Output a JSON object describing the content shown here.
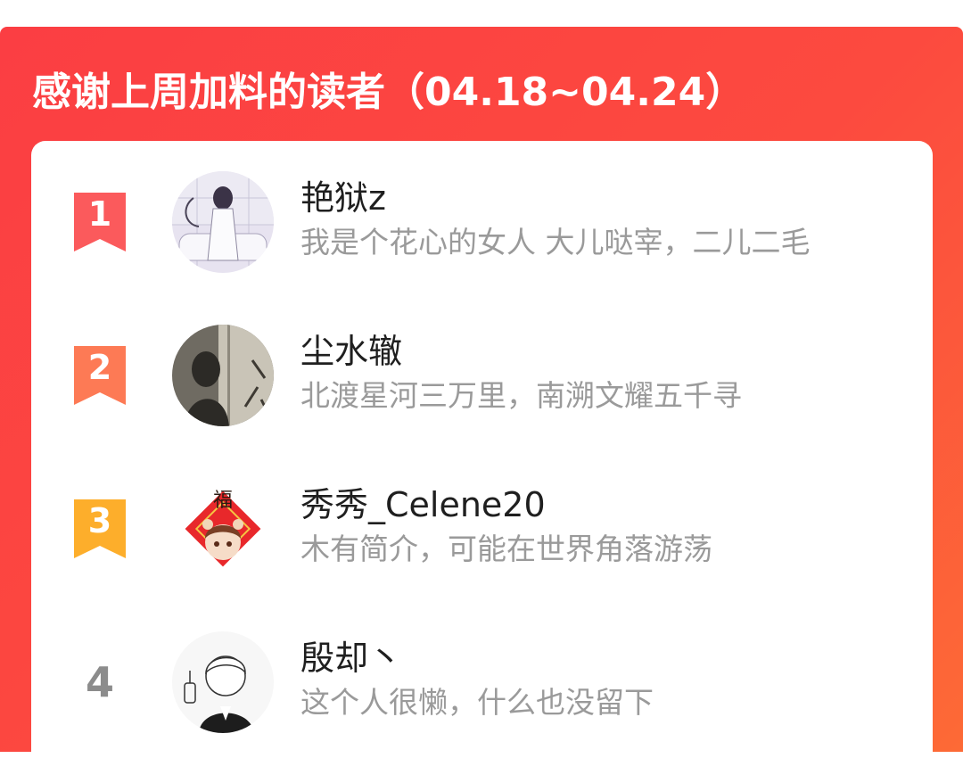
{
  "panel": {
    "title": "感谢上周加料的读者（04.18~04.24）"
  },
  "colors": {
    "panel_gradient_start": "#fb3e43",
    "panel_gradient_end": "#fd6a36",
    "rank1": "#fb5a5c",
    "rank2": "#fd7a55",
    "rank3": "#fdae2b",
    "rank_plain": "#8c8c8c",
    "username": "#1f1f1f",
    "bio": "#9a9a9a"
  },
  "readers": [
    {
      "rank": "1",
      "username": "艳狱z",
      "bio": "我是个花心的女人 大儿哒宰，二儿二毛",
      "avatar_icon": "illustrated-girl-avatar-icon"
    },
    {
      "rank": "2",
      "username": "尘水辙",
      "bio": "北渡星河三万里，南溯文耀五千寻",
      "avatar_icon": "shadow-silhouette-avatar-icon"
    },
    {
      "rank": "3",
      "username": "秀秀_Celene20",
      "bio": "木有简介，可能在世界角落游荡",
      "avatar_icon": "fu-character-avatar-icon",
      "avatar_text": "福"
    },
    {
      "rank": "4",
      "username": "殷却丶",
      "bio": "这个人很懒，什么也没留下",
      "avatar_icon": "sketched-boy-avatar-icon"
    }
  ]
}
